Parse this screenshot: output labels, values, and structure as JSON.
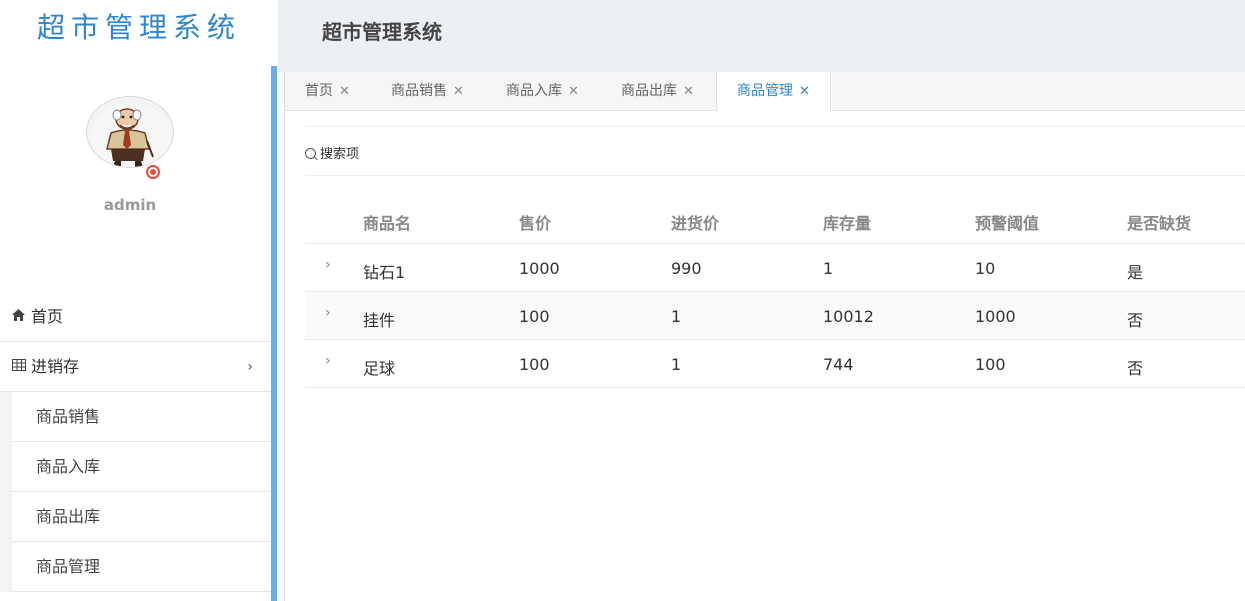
{
  "app": {
    "logo_text": "超市管理系统",
    "header_title": "超市管理系统"
  },
  "user": {
    "name": "admin",
    "avatar_icon": "user-avatar-cartoon",
    "status_icon": "status-dot-icon"
  },
  "sidebar": {
    "home_label": "首页",
    "home_icon": "home-icon",
    "group_label": "进销存",
    "group_icon": "table-icon",
    "group_chevron": "chevron-right-icon",
    "sub_items": [
      "商品销售",
      "商品入库",
      "商品出库",
      "商品管理"
    ]
  },
  "tabs": [
    {
      "label": "首页",
      "active": false
    },
    {
      "label": "商品销售",
      "active": false
    },
    {
      "label": "商品入库",
      "active": false
    },
    {
      "label": "商品出库",
      "active": false
    },
    {
      "label": "商品管理",
      "active": true
    }
  ],
  "search": {
    "label": "搜索项",
    "icon": "search-icon"
  },
  "table": {
    "columns": [
      "商品名",
      "售价",
      "进货价",
      "库存量",
      "预警阈值",
      "是否缺货"
    ],
    "rows": [
      [
        "钻石1",
        "1000",
        "990",
        "1",
        "10",
        "是"
      ],
      [
        "挂件",
        "100",
        "1",
        "10012",
        "1000",
        "否"
      ],
      [
        "足球",
        "100",
        "1",
        "744",
        "100",
        "否"
      ]
    ]
  },
  "colors": {
    "accent": "#2e86d1",
    "sidebar_accent": "#6aaeea",
    "header_bg": "#edf0f3"
  }
}
